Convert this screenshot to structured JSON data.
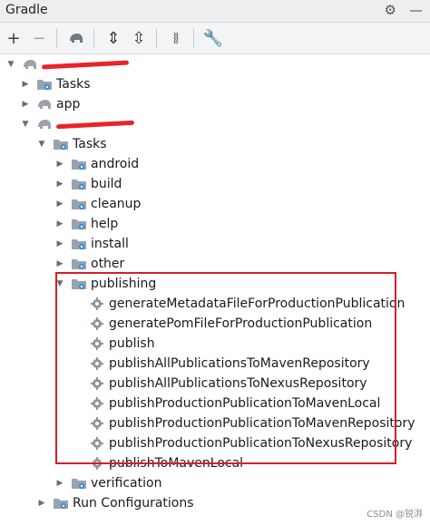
{
  "panel": {
    "title": "Gradle"
  },
  "icons": {
    "settings": "gear-icon",
    "minimize": "minimize-icon",
    "folder": "folder-gear-icon",
    "task": "gear-icon",
    "module": "elephant-icon"
  },
  "tree": {
    "root_label": "",
    "tasks_label": "Tasks",
    "app_label": "app",
    "module_label": "",
    "module_tasks_label": "Tasks",
    "groups": [
      "android",
      "build",
      "cleanup",
      "help",
      "install",
      "other"
    ],
    "publishing": {
      "label": "publishing",
      "tasks": [
        "generateMetadataFileForProductionPublication",
        "generatePomFileForProductionPublication",
        "publish",
        "publishAllPublicationsToMavenRepository",
        "publishAllPublicationsToNexusRepository",
        "publishProductionPublicationToMavenLocal",
        "publishProductionPublicationToMavenRepository",
        "publishProductionPublicationToNexusRepository",
        "publishToMavenLocal"
      ]
    },
    "verification_label": "verification",
    "run_configurations_label": "Run Configurations"
  },
  "watermark": "CSDN @锐湃",
  "colors": {
    "highlight": "#d3202a",
    "redaction": "#e8242a",
    "icon_blue": "#3e8ed0"
  }
}
